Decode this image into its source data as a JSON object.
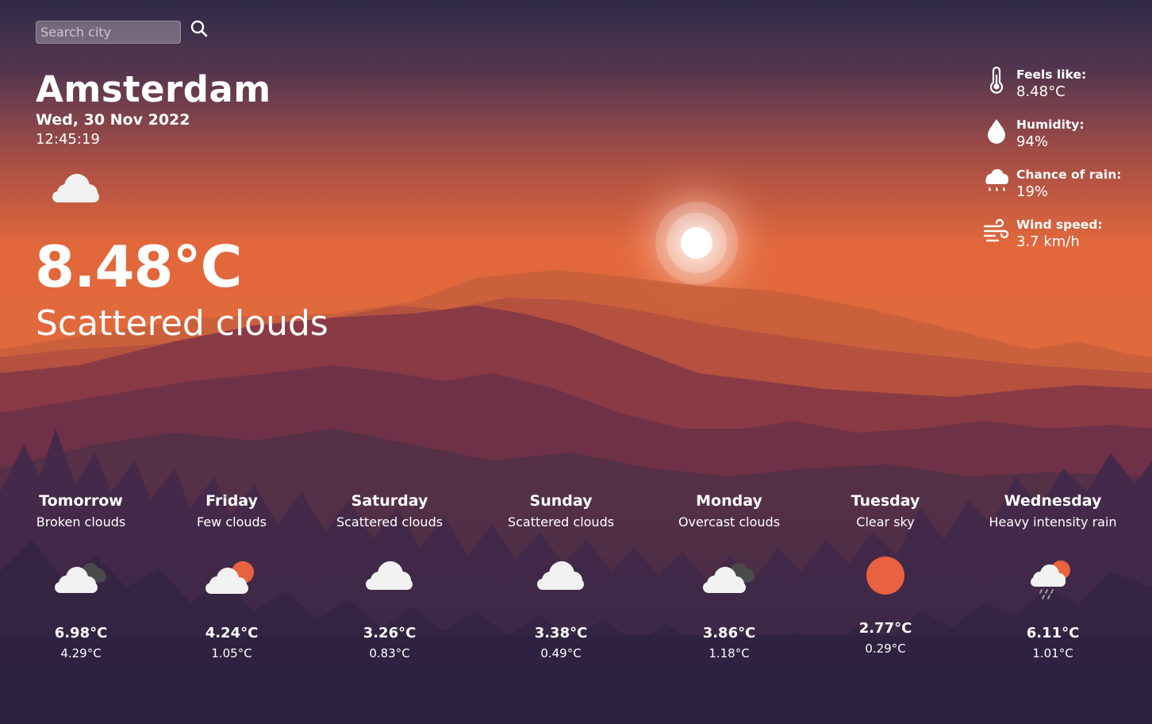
{
  "search": {
    "placeholder": "Search city"
  },
  "current": {
    "city": "Amsterdam",
    "date": "Wed, 30 Nov 2022",
    "time": "12:45:19",
    "temp": "8.48°C",
    "description": "Scattered clouds",
    "icon": "cloud-icon"
  },
  "details": {
    "feels_like": {
      "label": "Feels like:",
      "value": "8.48°C",
      "icon": "thermometer-icon"
    },
    "humidity": {
      "label": "Humidity:",
      "value": "94%",
      "icon": "droplet-icon"
    },
    "chance_of_rain": {
      "label": "Chance of rain:",
      "value": "19%",
      "icon": "rain-cloud-icon"
    },
    "wind_speed": {
      "label": "Wind speed:",
      "value": "3.7 km/h",
      "icon": "wind-icon"
    }
  },
  "forecast": [
    {
      "day": "Tomorrow",
      "description": "Broken clouds",
      "high": "6.98°C",
      "low": "4.29°C",
      "icon": "broken-clouds-icon"
    },
    {
      "day": "Friday",
      "description": "Few clouds",
      "high": "4.24°C",
      "low": "1.05°C",
      "icon": "few-clouds-icon"
    },
    {
      "day": "Saturday",
      "description": "Scattered clouds",
      "high": "3.26°C",
      "low": "0.83°C",
      "icon": "cloud-icon"
    },
    {
      "day": "Sunday",
      "description": "Scattered clouds",
      "high": "3.38°C",
      "low": "0.49°C",
      "icon": "cloud-icon"
    },
    {
      "day": "Monday",
      "description": "Overcast clouds",
      "high": "3.86°C",
      "low": "1.18°C",
      "icon": "overcast-clouds-icon"
    },
    {
      "day": "Tuesday",
      "description": "Clear sky",
      "high": "2.77°C",
      "low": "0.29°C",
      "icon": "sun-icon"
    },
    {
      "day": "Wednesday",
      "description": "Heavy intensity rain",
      "high": "6.11°C",
      "low": "1.01°C",
      "icon": "rain-icon"
    }
  ],
  "colors": {
    "sky_top": "#2f2a48",
    "sky_mid": "#e2683c",
    "sun_accent": "#e8623f",
    "cloud": "#f2f2f2",
    "dark_cloud": "#4a4a4a",
    "text": "#ffffff"
  }
}
